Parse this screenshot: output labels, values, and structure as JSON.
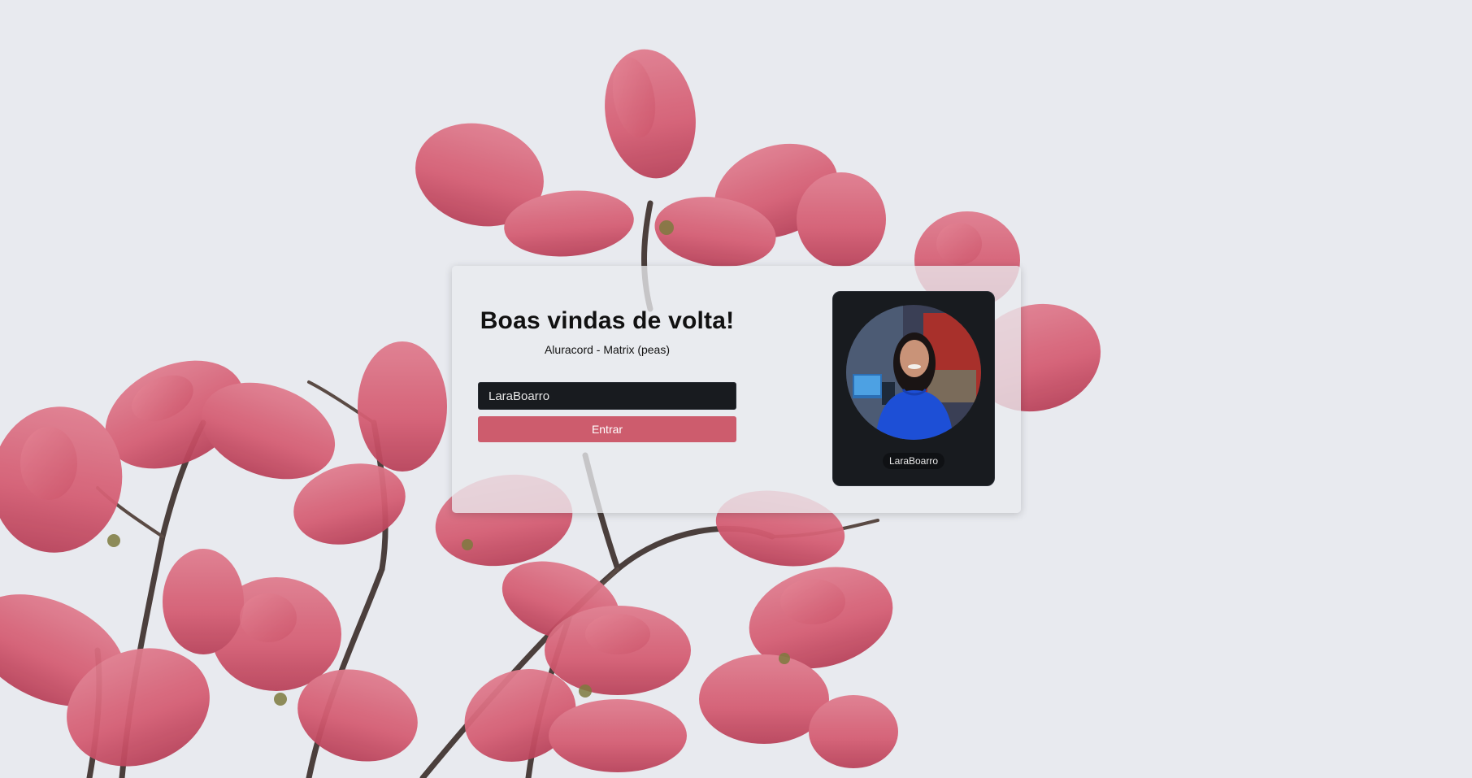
{
  "page": {
    "title": "Boas vindas de volta!",
    "subtitle": "Aluracord - Matrix (peas)"
  },
  "login_form": {
    "username_value": "LaraBoarro",
    "submit_label": "Entrar"
  },
  "profile": {
    "username": "LaraBoarro"
  },
  "colors": {
    "background": "#e8eaef",
    "card": "#e9ebee",
    "panel_dark": "#181b1f",
    "button_accent": "#cd5c6d",
    "flower_pink": "#d9677b"
  },
  "icons": {
    "avatar": "profile-photo"
  }
}
